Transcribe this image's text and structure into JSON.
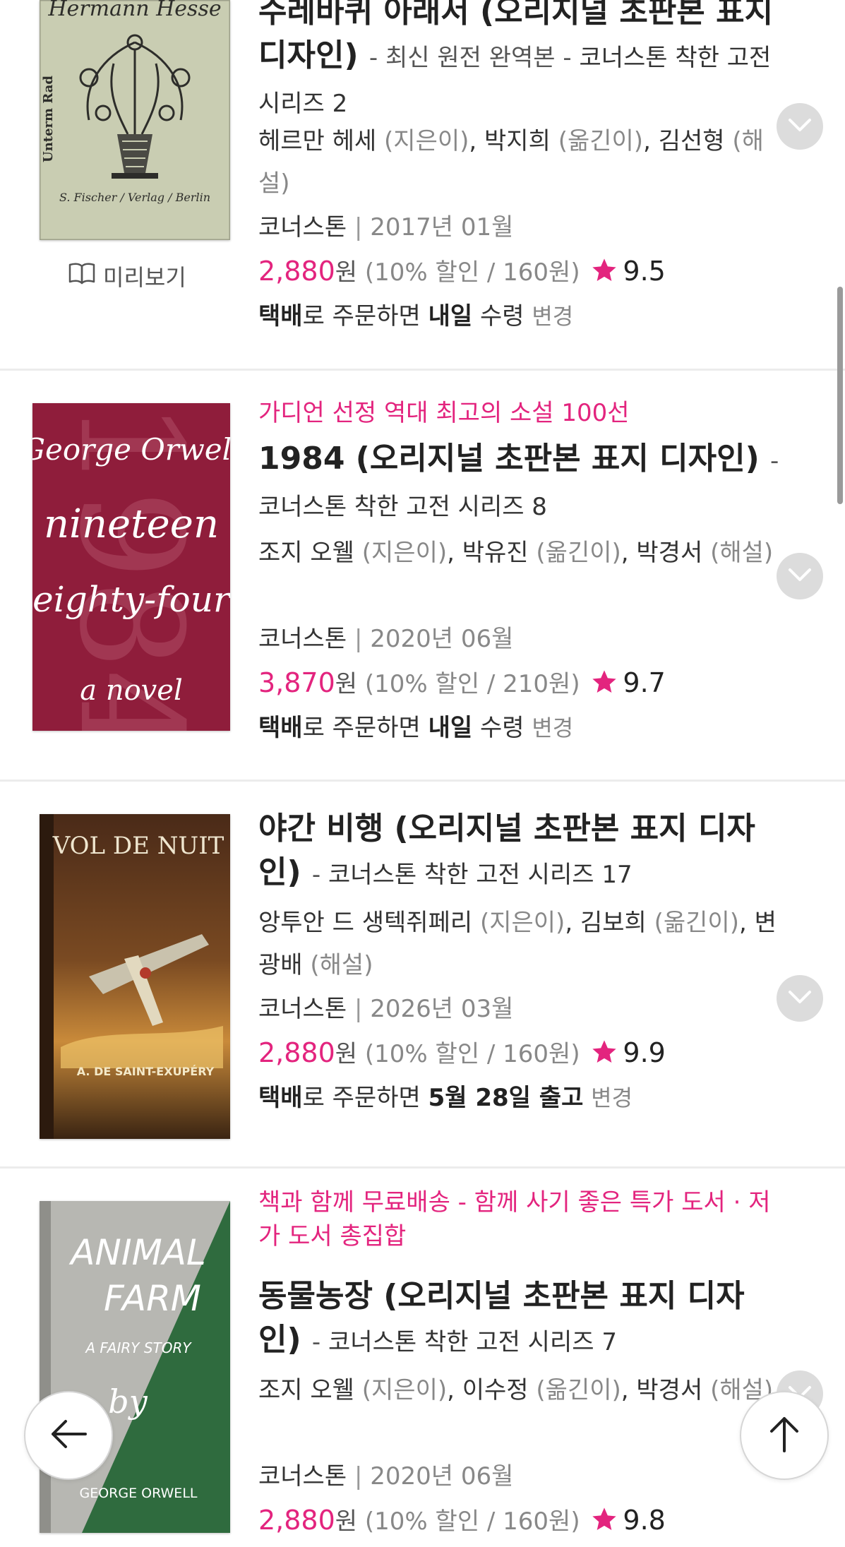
{
  "books": [
    {
      "title": "수레바퀴 아래서 (오리지널 초판본 표지 디자인)",
      "subtitle": "최신 원전 완역본",
      "series": "코너스톤 착한 고전 시리즈 2",
      "authors": [
        {
          "name": "헤르만 헤세",
          "role": "(지은이)"
        },
        {
          "name": "박지희",
          "role": "(옮긴이)"
        },
        {
          "name": "김선형",
          "role": "(해설)"
        }
      ],
      "publisher": "코너스톤",
      "date": "2017년 01월",
      "price": "2,880",
      "price_unit": "원",
      "discount": "(10% 할인 / 160원)",
      "rating": "9.5",
      "shipping": {
        "method": "택배",
        "middle": "로 주문하면",
        "when": "내일",
        "suffix": "수령",
        "change": "변경"
      },
      "preview_label": "미리보기",
      "cover": {
        "author_text": "Hermann Hesse",
        "publisher_text": "S. Fischer / Verlag / Berlin",
        "spine_text": "Unterm Rad"
      }
    },
    {
      "badge": "가디언 선정 역대 최고의 소설 100선",
      "title": "1984 (오리지널 초판본 표지 디자인)",
      "series": "코너스톤 착한 고전 시리즈 8",
      "authors": [
        {
          "name": "조지 오웰",
          "role": "(지은이)"
        },
        {
          "name": "박유진",
          "role": "(옮긴이)"
        },
        {
          "name": "박경서",
          "role": "(해설)"
        }
      ],
      "publisher": "코너스톤",
      "date": "2020년 06월",
      "price": "3,870",
      "price_unit": "원",
      "discount": "(10% 할인 / 210원)",
      "rating": "9.7",
      "shipping": {
        "method": "택배",
        "middle": "로 주문하면",
        "when": "내일",
        "suffix": "수령",
        "change": "변경"
      },
      "cover": {
        "line1": "George Orwell",
        "line2": "nineteen",
        "line3": "eighty-four",
        "line4": "a novel",
        "bignum": "1984"
      }
    },
    {
      "title": "야간 비행 (오리지널 초판본 표지 디자인)",
      "series": "코너스톤 착한 고전 시리즈 17",
      "authors": [
        {
          "name": "앙투안 드 생텍쥐페리",
          "role": "(지은이)"
        },
        {
          "name": "김보희",
          "role": "(옮긴이)"
        },
        {
          "name": "변광배",
          "role": "(해설)"
        }
      ],
      "publisher": "코너스톤",
      "date": "2026년 03월",
      "price": "2,880",
      "price_unit": "원",
      "discount": "(10% 할인 / 160원)",
      "rating": "9.9",
      "shipping": {
        "method": "택배",
        "middle": "로 주문하면",
        "when": "5월 28일 출고",
        "suffix": "",
        "change": "변경"
      },
      "cover": {
        "title": "VOL DE NUIT",
        "author": "A. DE SAINT-EXUPÉRY"
      }
    },
    {
      "badge": "책과 함께 무료배송 - 함께 사기 좋은 특가 도서 · 저가 도서 총집합",
      "title": "동물농장 (오리지널 초판본 표지 디자인)",
      "series": "코너스톤 착한 고전 시리즈 7",
      "authors": [
        {
          "name": "조지 오웰",
          "role": "(지은이)"
        },
        {
          "name": "이수정",
          "role": "(옮긴이)"
        },
        {
          "name": "박경서",
          "role": "(해설)"
        }
      ],
      "publisher": "코너스톤",
      "date": "2020년 06월",
      "price": "2,880",
      "price_unit": "원",
      "discount": "(10% 할인 / 160원)",
      "rating": "9.8",
      "cover": {
        "line1": "ANIMAL",
        "line2": "FARM",
        "line3": "A FAIRY STORY",
        "line4": "by",
        "line5": "GEORGE ORWELL"
      }
    }
  ],
  "separator": "|",
  "dash": "-",
  "comma": ",",
  "icons": {
    "expand": "chevron-down-icon",
    "back": "arrow-left-icon",
    "top": "arrow-up-icon",
    "rating": "star-icon",
    "preview": "book-open-icon"
  },
  "colors": {
    "accent": "#e3247e",
    "muted": "#888888",
    "divider": "#ececec"
  }
}
